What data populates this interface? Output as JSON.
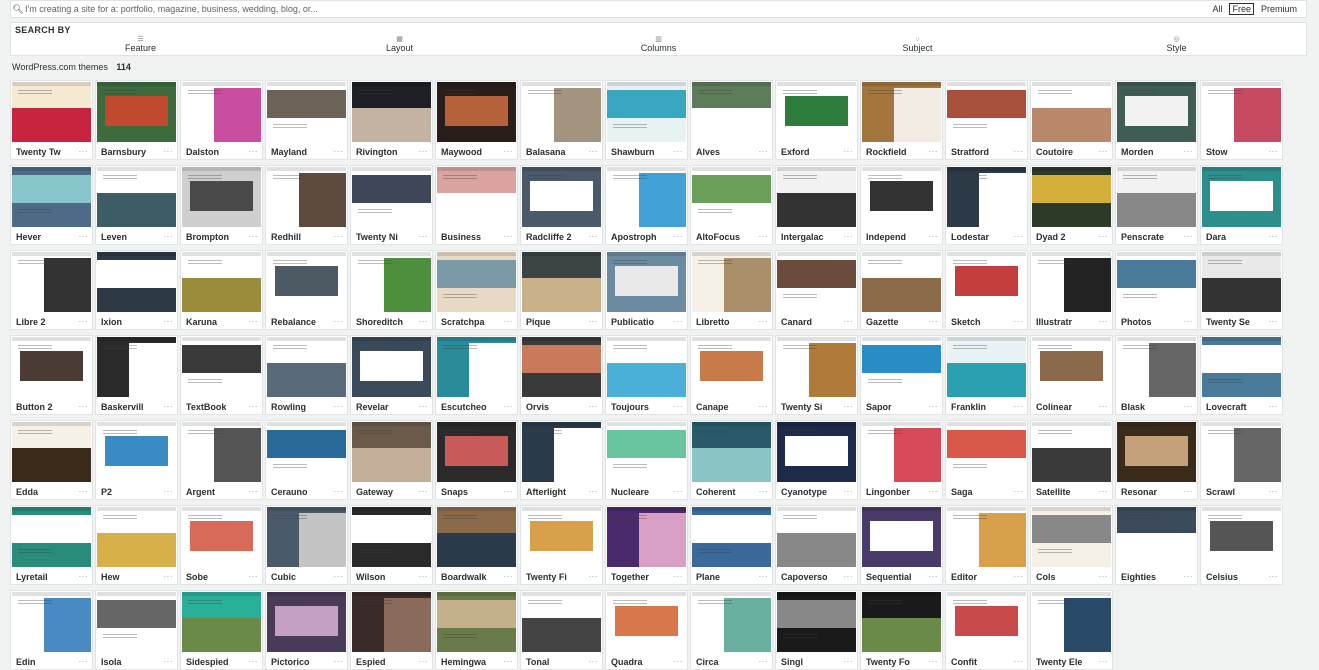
{
  "search": {
    "placeholder": "I'm creating a site for a: portfolio, magazine, business, wedding, blog, or...",
    "filters": [
      "All",
      "Free",
      "Premium"
    ],
    "active_filter": "Free"
  },
  "search_by": {
    "title": "SEARCH BY",
    "facets": [
      {
        "label": "Feature",
        "icon": "feature-icon"
      },
      {
        "label": "Layout",
        "icon": "layout-icon"
      },
      {
        "label": "Columns",
        "icon": "columns-icon"
      },
      {
        "label": "Subject",
        "icon": "subject-icon"
      },
      {
        "label": "Style",
        "icon": "style-icon"
      }
    ]
  },
  "results": {
    "label": "WordPress.com themes",
    "count": "114"
  },
  "themes": [
    {
      "name": "Twenty Tw",
      "c1": "#f5e9d4",
      "c2": "#c8243f"
    },
    {
      "name": "Barnsbury",
      "c1": "#3d6b3c",
      "c2": "#c14a2e"
    },
    {
      "name": "Dalston",
      "c1": "#ffffff",
      "c2": "#c94ea0"
    },
    {
      "name": "Mayland",
      "c1": "#ffffff",
      "c2": "#6d6257"
    },
    {
      "name": "Rivington",
      "c1": "#1d1f24",
      "c2": "#c4b3a2"
    },
    {
      "name": "Maywood",
      "c1": "#2a1e1b",
      "c2": "#b5623b"
    },
    {
      "name": "Balasana",
      "c1": "#ffffff",
      "c2": "#a39480"
    },
    {
      "name": "Shawburn",
      "c1": "#e9f2f3",
      "c2": "#39a7c2"
    },
    {
      "name": "Alves",
      "c1": "#5e7b5a",
      "c2": "#ffffff"
    },
    {
      "name": "Exford",
      "c1": "#ffffff",
      "c2": "#2e7c3c"
    },
    {
      "name": "Rockfield",
      "c1": "#a3763e",
      "c2": "#f2ece4"
    },
    {
      "name": "Stratford",
      "c1": "#ffffff",
      "c2": "#a8503c"
    },
    {
      "name": "Coutoire",
      "c1": "#ffffff",
      "c2": "#b9876a"
    },
    {
      "name": "Morden",
      "c1": "#3f5d55",
      "c2": "#f2f2f2"
    },
    {
      "name": "Stow",
      "c1": "#ffffff",
      "c2": "#c74a63"
    },
    {
      "name": "Hever",
      "c1": "#4d6b86",
      "c2": "#89c6cc"
    },
    {
      "name": "Leven",
      "c1": "#ffffff",
      "c2": "#3c5d64"
    },
    {
      "name": "Brompton",
      "c1": "#cfcfcf",
      "c2": "#4a4a4a"
    },
    {
      "name": "Redhill",
      "c1": "#ffffff",
      "c2": "#5f4a3e"
    },
    {
      "name": "Twenty Ni",
      "c1": "#ffffff",
      "c2": "#3d4759"
    },
    {
      "name": "Business",
      "c1": "#d9a3a0",
      "c2": "#ffffff"
    },
    {
      "name": "Radcliffe 2",
      "c1": "#4a5a6a",
      "c2": "#ffffff"
    },
    {
      "name": "Apostroph",
      "c1": "#ffffff",
      "c2": "#42a2d8"
    },
    {
      "name": "AltoFocus",
      "c1": "#ffffff",
      "c2": "#6aa05a"
    },
    {
      "name": "Intergalac",
      "c1": "#f2f2f2",
      "c2": "#333333"
    },
    {
      "name": "Independ",
      "c1": "#ffffff",
      "c2": "#333333"
    },
    {
      "name": "Lodestar",
      "c1": "#2b3a46",
      "c2": "#ffffff"
    },
    {
      "name": "Dyad 2",
      "c1": "#2c3a28",
      "c2": "#d3b03a"
    },
    {
      "name": "Penscrate",
      "c1": "#f2f2f2",
      "c2": "#888888"
    },
    {
      "name": "Dara",
      "c1": "#2c8f8c",
      "c2": "#ffffff"
    },
    {
      "name": "Libre 2",
      "c1": "#ffffff",
      "c2": "#333333"
    },
    {
      "name": "Ixion",
      "c1": "#2d3a46",
      "c2": "#ffffff"
    },
    {
      "name": "Karuna",
      "c1": "#ffffff",
      "c2": "#9a8c3a"
    },
    {
      "name": "Rebalance",
      "c1": "#ffffff",
      "c2": "#4d5a64"
    },
    {
      "name": "Shoreditch",
      "c1": "#ffffff",
      "c2": "#4d8f3c"
    },
    {
      "name": "Scratchpa",
      "c1": "#e8d9c4",
      "c2": "#7b9aa8"
    },
    {
      "name": "Pique",
      "c1": "#3d4446",
      "c2": "#c9b28a"
    },
    {
      "name": "Publicatio",
      "c1": "#6c8ba0",
      "c2": "#e9e9e9"
    },
    {
      "name": "Libretto",
      "c1": "#f6f1e6",
      "c2": "#a98f6a"
    },
    {
      "name": "Canard",
      "c1": "#ffffff",
      "c2": "#6a4b3c"
    },
    {
      "name": "Gazette",
      "c1": "#ffffff",
      "c2": "#8c6b4a"
    },
    {
      "name": "Sketch",
      "c1": "#ffffff",
      "c2": "#c53e3e"
    },
    {
      "name": "Illustratr",
      "c1": "#ffffff",
      "c2": "#222222"
    },
    {
      "name": "Photos",
      "c1": "#ffffff",
      "c2": "#4a7a9a"
    },
    {
      "name": "Twenty Se",
      "c1": "#e9e9e9",
      "c2": "#333333"
    },
    {
      "name": "Button 2",
      "c1": "#ffffff",
      "c2": "#4a3c34"
    },
    {
      "name": "Baskervill",
      "c1": "#2a2a2a",
      "c2": "#ffffff"
    },
    {
      "name": "TextBook",
      "c1": "#ffffff",
      "c2": "#3a3a3a"
    },
    {
      "name": "Rowling",
      "c1": "#ffffff",
      "c2": "#5a6a7a"
    },
    {
      "name": "Revelar",
      "c1": "#3a4a5a",
      "c2": "#ffffff"
    },
    {
      "name": "Escutcheo",
      "c1": "#2a8c9a",
      "c2": "#ffffff"
    },
    {
      "name": "Orvis",
      "c1": "#3a3a3a",
      "c2": "#c97a5a"
    },
    {
      "name": "Toujours",
      "c1": "#ffffff",
      "c2": "#4ab0d8"
    },
    {
      "name": "Canape",
      "c1": "#ffffff",
      "c2": "#c97a4a"
    },
    {
      "name": "Twenty Si",
      "c1": "#ffffff",
      "c2": "#b07a3a"
    },
    {
      "name": "Sapor",
      "c1": "#ffffff",
      "c2": "#2a8cc4"
    },
    {
      "name": "Franklin",
      "c1": "#e9f2f4",
      "c2": "#2aa0b0"
    },
    {
      "name": "Colinear",
      "c1": "#ffffff",
      "c2": "#8a6a4a"
    },
    {
      "name": "Blask",
      "c1": "#ffffff",
      "c2": "#666666"
    },
    {
      "name": "Lovecraft",
      "c1": "#4a7a9a",
      "c2": "#ffffff"
    },
    {
      "name": "Edda",
      "c1": "#f6f1e6",
      "c2": "#3a2a1a"
    },
    {
      "name": "P2",
      "c1": "#ffffff",
      "c2": "#3a8ac4"
    },
    {
      "name": "Argent",
      "c1": "#ffffff",
      "c2": "#555555"
    },
    {
      "name": "Cerauno",
      "c1": "#ffffff",
      "c2": "#2a6a9a"
    },
    {
      "name": "Gateway",
      "c1": "#6a5a4a",
      "c2": "#c4b09a"
    },
    {
      "name": "Snaps",
      "c1": "#2a2a2a",
      "c2": "#c95a5a"
    },
    {
      "name": "Afterlight",
      "c1": "#2a3a4a",
      "c2": "#ffffff"
    },
    {
      "name": "Nucleare",
      "c1": "#ffffff",
      "c2": "#6ac4a0"
    },
    {
      "name": "Coherent",
      "c1": "#2a5a6a",
      "c2": "#8ac4c4"
    },
    {
      "name": "Cyanotype",
      "c1": "#1e2a4a",
      "c2": "#ffffff"
    },
    {
      "name": "Lingonber",
      "c1": "#ffffff",
      "c2": "#d84a5a"
    },
    {
      "name": "Saga",
      "c1": "#ffffff",
      "c2": "#d8584a"
    },
    {
      "name": "Satellite",
      "c1": "#ffffff",
      "c2": "#3a3a3a"
    },
    {
      "name": "Resonar",
      "c1": "#3a2a1a",
      "c2": "#c4a07a"
    },
    {
      "name": "Scrawl",
      "c1": "#ffffff",
      "c2": "#666666"
    },
    {
      "name": "Lyretail",
      "c1": "#2a8c7a",
      "c2": "#ffffff"
    },
    {
      "name": "Hew",
      "c1": "#ffffff",
      "c2": "#d8b04a"
    },
    {
      "name": "Sobe",
      "c1": "#ffffff",
      "c2": "#d86a5a"
    },
    {
      "name": "Cubic",
      "c1": "#4a5a6a",
      "c2": "#c4c4c4"
    },
    {
      "name": "Wilson",
      "c1": "#2a2a2a",
      "c2": "#ffffff"
    },
    {
      "name": "Boardwalk",
      "c1": "#8a6a4a",
      "c2": "#2a3a4a"
    },
    {
      "name": "Twenty Fi",
      "c1": "#ffffff",
      "c2": "#d8a04a"
    },
    {
      "name": "Together",
      "c1": "#4a2a6a",
      "c2": "#d8a0c4"
    },
    {
      "name": "Plane",
      "c1": "#3a6a9a",
      "c2": "#ffffff"
    },
    {
      "name": "Capoverso",
      "c1": "#ffffff",
      "c2": "#888888"
    },
    {
      "name": "Sequential",
      "c1": "#4a3a6a",
      "c2": "#ffffff"
    },
    {
      "name": "Editor",
      "c1": "#ffffff",
      "c2": "#d8a04a"
    },
    {
      "name": "Cols",
      "c1": "#f6f1e6",
      "c2": "#888888"
    },
    {
      "name": "Eighties",
      "c1": "#3a4a5a",
      "c2": "#ffffff"
    },
    {
      "name": "Celsius",
      "c1": "#ffffff",
      "c2": "#555555"
    },
    {
      "name": "Edin",
      "c1": "#ffffff",
      "c2": "#4a8ac4"
    },
    {
      "name": "Isola",
      "c1": "#ffffff",
      "c2": "#666666"
    },
    {
      "name": "Sidespied",
      "c1": "#2ab09a",
      "c2": "#6a8a4a"
    },
    {
      "name": "Pictorico",
      "c1": "#4a3a5a",
      "c2": "#c4a0c4"
    },
    {
      "name": "Espied",
      "c1": "#3a2a2a",
      "c2": "#8a6a5a"
    },
    {
      "name": "Hemingwa",
      "c1": "#6a7a4a",
      "c2": "#c4b08a"
    },
    {
      "name": "Tonal",
      "c1": "#ffffff",
      "c2": "#444444"
    },
    {
      "name": "Quadra",
      "c1": "#ffffff",
      "c2": "#d8784a"
    },
    {
      "name": "Circa",
      "c1": "#ffffff",
      "c2": "#6ab0a0"
    },
    {
      "name": "Singl",
      "c1": "#1a1a1a",
      "c2": "#888888"
    },
    {
      "name": "Twenty Fo",
      "c1": "#1a1a1a",
      "c2": "#6a8a4a"
    },
    {
      "name": "Confit",
      "c1": "#ffffff",
      "c2": "#c94a4a"
    },
    {
      "name": "Twenty Ele",
      "c1": "#ffffff",
      "c2": "#2a4a6a"
    }
  ],
  "more_glyph": "···"
}
